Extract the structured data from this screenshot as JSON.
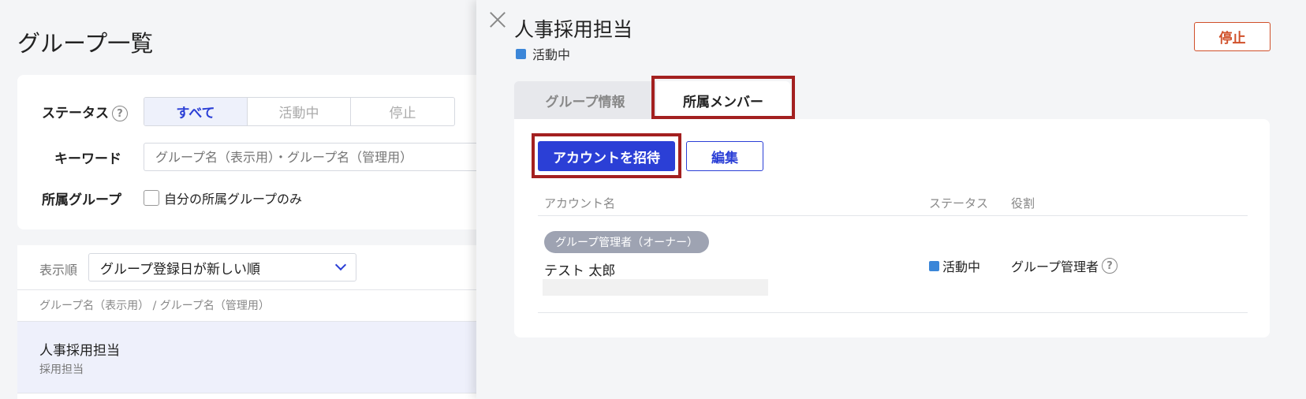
{
  "background": {
    "page_title": "グループ一覧",
    "filter": {
      "status_label": "ステータス",
      "status_options": [
        "すべて",
        "活動中",
        "停止"
      ],
      "keyword_label": "キーワード",
      "keyword_placeholder": "グループ名（表示用）・グループ名（管理用）",
      "group_label": "所属グループ",
      "group_checkbox_label": "自分の所属グループのみ"
    },
    "list": {
      "sort_label": "表示順",
      "sort_value": "グループ登録日が新しい順",
      "column_header": "グループ名（表示用） / グループ名（管理用）",
      "rows": [
        {
          "name": "人事採用担当",
          "sub": "採用担当"
        }
      ]
    }
  },
  "drawer": {
    "title": "人事採用担当",
    "status": "活動中",
    "status_color": "#3b86d8",
    "stop_button": "停止",
    "tabs": [
      {
        "label": "グループ情報",
        "active": false
      },
      {
        "label": "所属メンバー",
        "active": true
      }
    ],
    "invite_button": "アカウントを招待",
    "edit_button": "編集",
    "table": {
      "headers": [
        "アカウント名",
        "ステータス",
        "役割"
      ],
      "rows": [
        {
          "badge": "グループ管理者（オーナー）",
          "name": "テスト 太郎",
          "status": "活動中",
          "role": "グループ管理者"
        }
      ]
    }
  },
  "colors": {
    "primary": "#2b3fd6",
    "danger": "#d0502a",
    "highlight": "#a32020"
  }
}
